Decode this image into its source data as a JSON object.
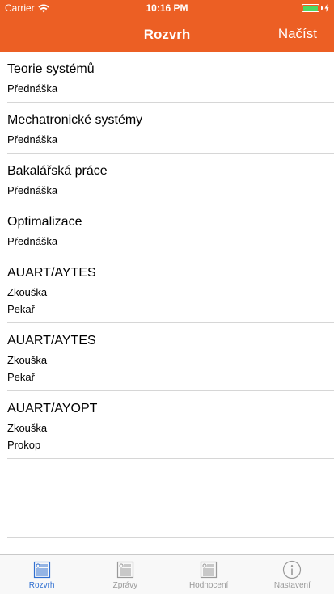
{
  "status_bar": {
    "carrier": "Carrier",
    "time": "10:16 PM",
    "battery_level": 1.0
  },
  "nav": {
    "title": "Rozvrh",
    "action_label": "Načíst"
  },
  "items": [
    {
      "title": "Teorie systémů",
      "lines": [
        "Přednáška"
      ]
    },
    {
      "title": "Mechatronické systémy",
      "lines": [
        "Přednáška"
      ]
    },
    {
      "title": "Bakalářská práce",
      "lines": [
        "Přednáška"
      ]
    },
    {
      "title": "Optimalizace",
      "lines": [
        "Přednáška"
      ]
    },
    {
      "title": "AUART/AYTES",
      "lines": [
        "Zkouška",
        "Pekař"
      ]
    },
    {
      "title": "AUART/AYTES",
      "lines": [
        "Zkouška",
        "Pekař"
      ]
    },
    {
      "title": "AUART/AYOPT",
      "lines": [
        "Zkouška",
        "Prokop"
      ]
    }
  ],
  "tabbar": {
    "tabs": [
      {
        "label": "Rozvrh",
        "icon": "list-document-icon",
        "active": true
      },
      {
        "label": "Zprávy",
        "icon": "list-document-icon",
        "active": false
      },
      {
        "label": "Hodnocení",
        "icon": "list-document-icon",
        "active": false
      },
      {
        "label": "Nastavení",
        "icon": "info-icon",
        "active": false
      }
    ]
  },
  "colors": {
    "header": "#ec5f24",
    "active_tab": "#2f6fd1",
    "inactive_tab": "#999999",
    "battery": "#4cd964"
  }
}
